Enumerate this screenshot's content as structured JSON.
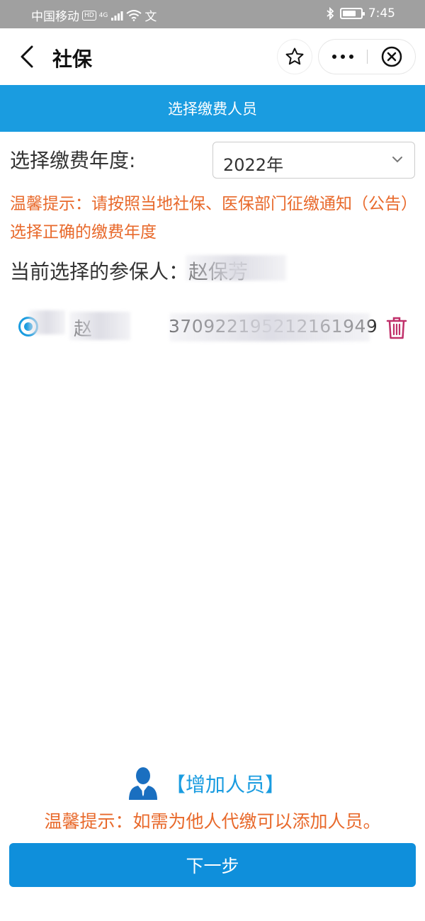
{
  "status_bar": {
    "carrier": "中国移动",
    "hd": "HD",
    "network": "4G",
    "extra": "文",
    "time": "7:45",
    "battery_level": 0.75
  },
  "nav": {
    "title": "社保"
  },
  "header": {
    "title": "选择缴费人员"
  },
  "year": {
    "label": "选择缴费年度:",
    "selected": "2022年"
  },
  "tip_top": "温馨提示：请按照当地社保、医保部门征缴通知（公告）选择正确的缴费年度",
  "current": {
    "label": "当前选择的参保人：赵保芳"
  },
  "member": {
    "name": "赵",
    "id_number": "370922195212161949",
    "selected": true
  },
  "add_person": {
    "label": "【增加人员】"
  },
  "tip_bottom": "温馨提示：如需为他人代缴可以添加人员。",
  "next_button": "下一步",
  "colors": {
    "brand_blue": "#1a9ce0",
    "warning_orange": "#e8692b",
    "button_blue": "#0f8fdb",
    "trash_red": "#c0306a"
  }
}
